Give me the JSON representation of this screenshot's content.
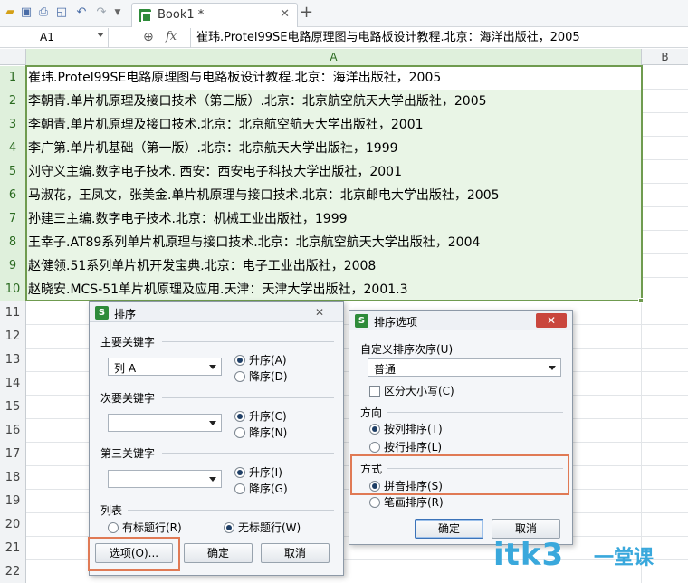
{
  "toolbar": {
    "icons": [
      "open-icon",
      "save-icon",
      "print-icon",
      "print-preview-icon",
      "undo-icon",
      "redo-icon"
    ],
    "tab_label": "Book1 *",
    "tab_close": "✕",
    "new_tab": "+"
  },
  "formula_bar": {
    "name_box": "A1",
    "fx": "fx",
    "content": "崔玮.Protel99SE电路原理图与电路板设计教程.北京：海洋出版社，2005"
  },
  "columns": [
    "A",
    "B"
  ],
  "rows": [
    {
      "num": "1",
      "a": "崔玮.Protel99SE电路原理图与电路板设计教程.北京：海洋出版社，2005"
    },
    {
      "num": "2",
      "a": "李朝青.单片机原理及接口技术（第三版）.北京：北京航空航天大学出版社，2005"
    },
    {
      "num": "3",
      "a": "李朝青.单片机原理及接口技术.北京：北京航空航天大学出版社，2001"
    },
    {
      "num": "4",
      "a": "李广第.单片机基础（第一版）.北京：北京航天大学出版社，1999"
    },
    {
      "num": "5",
      "a": "刘守义主编.数字电子技术. 西安：西安电子科技大学出版社，2001"
    },
    {
      "num": "6",
      "a": "马淑花，王凤文，张美金.单片机原理与接口技术.北京：北京邮电大学出版社，2005"
    },
    {
      "num": "7",
      "a": "孙建三主编.数字电子技术.北京：机械工业出版社，1999"
    },
    {
      "num": "8",
      "a": "王幸子.AT89系列单片机原理与接口技术.北京：北京航空航天大学出版社，2004"
    },
    {
      "num": "9",
      "a": "赵健领.51系列单片机开发宝典.北京：电子工业出版社，2008"
    },
    {
      "num": "10",
      "a": "赵晓安.MCS-51单片机原理及应用.天津：天津大学出版社，2001.3"
    },
    {
      "num": "11",
      "a": ""
    },
    {
      "num": "12",
      "a": ""
    },
    {
      "num": "13",
      "a": ""
    },
    {
      "num": "14",
      "a": ""
    },
    {
      "num": "15",
      "a": ""
    },
    {
      "num": "16",
      "a": ""
    },
    {
      "num": "17",
      "a": ""
    },
    {
      "num": "18",
      "a": ""
    },
    {
      "num": "19",
      "a": ""
    },
    {
      "num": "20",
      "a": ""
    },
    {
      "num": "21",
      "a": ""
    },
    {
      "num": "22",
      "a": ""
    }
  ],
  "sort_dialog": {
    "title": "排序",
    "close": "✕",
    "primary_key_label": "主要关键字",
    "primary_key_value": "列 A",
    "primary_asc": "升序(A)",
    "primary_desc": "降序(D)",
    "secondary_key_label": "次要关键字",
    "secondary_asc": "升序(C)",
    "secondary_desc": "降序(N)",
    "third_key_label": "第三关键字",
    "third_asc": "升序(I)",
    "third_desc": "降序(G)",
    "list_label": "列表",
    "has_header": "有标题行(R)",
    "no_header": "无标题行(W)",
    "options_button": "选项(O)...",
    "ok_button": "确定",
    "cancel_button": "取消"
  },
  "options_dialog": {
    "title": "排序选项",
    "close": "✕",
    "custom_order_label": "自定义排序次序(U)",
    "custom_order_value": "普通",
    "case_sensitive": "区分大小写(C)",
    "direction_label": "方向",
    "by_column": "按列排序(T)",
    "by_row": "按行排序(L)",
    "method_label": "方式",
    "pinyin": "拼音排序(S)",
    "stroke": "笔画排序(R)",
    "ok_button": "确定",
    "cancel_button": "取消"
  },
  "watermark": {
    "text": "itk3",
    "suffix": "一堂课"
  },
  "colors": {
    "accent_green": "#6f9b4f",
    "highlight_orange": "#e07a55",
    "watermark_blue": "#39a8dc"
  }
}
